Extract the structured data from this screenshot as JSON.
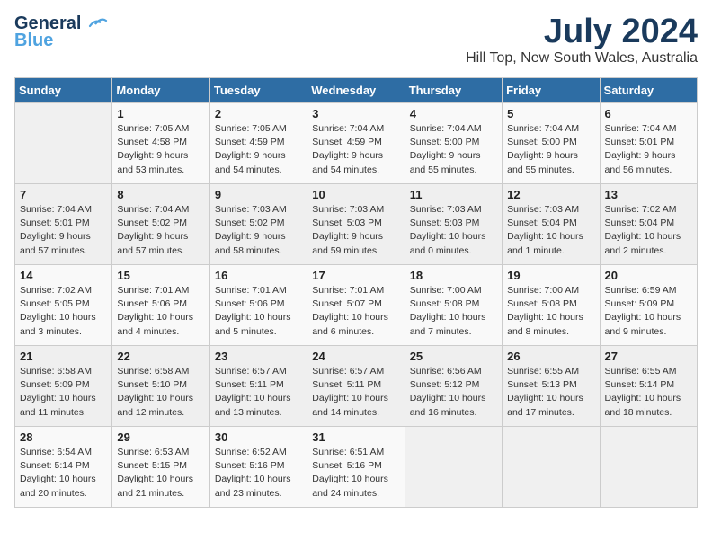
{
  "header": {
    "logo_line1": "General",
    "logo_line2": "Blue",
    "month_title": "July 2024",
    "location": "Hill Top, New South Wales, Australia"
  },
  "days_of_week": [
    "Sunday",
    "Monday",
    "Tuesday",
    "Wednesday",
    "Thursday",
    "Friday",
    "Saturday"
  ],
  "weeks": [
    [
      {
        "day": "",
        "info": ""
      },
      {
        "day": "1",
        "info": "Sunrise: 7:05 AM\nSunset: 4:58 PM\nDaylight: 9 hours\nand 53 minutes."
      },
      {
        "day": "2",
        "info": "Sunrise: 7:05 AM\nSunset: 4:59 PM\nDaylight: 9 hours\nand 54 minutes."
      },
      {
        "day": "3",
        "info": "Sunrise: 7:04 AM\nSunset: 4:59 PM\nDaylight: 9 hours\nand 54 minutes."
      },
      {
        "day": "4",
        "info": "Sunrise: 7:04 AM\nSunset: 5:00 PM\nDaylight: 9 hours\nand 55 minutes."
      },
      {
        "day": "5",
        "info": "Sunrise: 7:04 AM\nSunset: 5:00 PM\nDaylight: 9 hours\nand 55 minutes."
      },
      {
        "day": "6",
        "info": "Sunrise: 7:04 AM\nSunset: 5:01 PM\nDaylight: 9 hours\nand 56 minutes."
      }
    ],
    [
      {
        "day": "7",
        "info": "Sunrise: 7:04 AM\nSunset: 5:01 PM\nDaylight: 9 hours\nand 57 minutes."
      },
      {
        "day": "8",
        "info": "Sunrise: 7:04 AM\nSunset: 5:02 PM\nDaylight: 9 hours\nand 57 minutes."
      },
      {
        "day": "9",
        "info": "Sunrise: 7:03 AM\nSunset: 5:02 PM\nDaylight: 9 hours\nand 58 minutes."
      },
      {
        "day": "10",
        "info": "Sunrise: 7:03 AM\nSunset: 5:03 PM\nDaylight: 9 hours\nand 59 minutes."
      },
      {
        "day": "11",
        "info": "Sunrise: 7:03 AM\nSunset: 5:03 PM\nDaylight: 10 hours\nand 0 minutes."
      },
      {
        "day": "12",
        "info": "Sunrise: 7:03 AM\nSunset: 5:04 PM\nDaylight: 10 hours\nand 1 minute."
      },
      {
        "day": "13",
        "info": "Sunrise: 7:02 AM\nSunset: 5:04 PM\nDaylight: 10 hours\nand 2 minutes."
      }
    ],
    [
      {
        "day": "14",
        "info": "Sunrise: 7:02 AM\nSunset: 5:05 PM\nDaylight: 10 hours\nand 3 minutes."
      },
      {
        "day": "15",
        "info": "Sunrise: 7:01 AM\nSunset: 5:06 PM\nDaylight: 10 hours\nand 4 minutes."
      },
      {
        "day": "16",
        "info": "Sunrise: 7:01 AM\nSunset: 5:06 PM\nDaylight: 10 hours\nand 5 minutes."
      },
      {
        "day": "17",
        "info": "Sunrise: 7:01 AM\nSunset: 5:07 PM\nDaylight: 10 hours\nand 6 minutes."
      },
      {
        "day": "18",
        "info": "Sunrise: 7:00 AM\nSunset: 5:08 PM\nDaylight: 10 hours\nand 7 minutes."
      },
      {
        "day": "19",
        "info": "Sunrise: 7:00 AM\nSunset: 5:08 PM\nDaylight: 10 hours\nand 8 minutes."
      },
      {
        "day": "20",
        "info": "Sunrise: 6:59 AM\nSunset: 5:09 PM\nDaylight: 10 hours\nand 9 minutes."
      }
    ],
    [
      {
        "day": "21",
        "info": "Sunrise: 6:58 AM\nSunset: 5:09 PM\nDaylight: 10 hours\nand 11 minutes."
      },
      {
        "day": "22",
        "info": "Sunrise: 6:58 AM\nSunset: 5:10 PM\nDaylight: 10 hours\nand 12 minutes."
      },
      {
        "day": "23",
        "info": "Sunrise: 6:57 AM\nSunset: 5:11 PM\nDaylight: 10 hours\nand 13 minutes."
      },
      {
        "day": "24",
        "info": "Sunrise: 6:57 AM\nSunset: 5:11 PM\nDaylight: 10 hours\nand 14 minutes."
      },
      {
        "day": "25",
        "info": "Sunrise: 6:56 AM\nSunset: 5:12 PM\nDaylight: 10 hours\nand 16 minutes."
      },
      {
        "day": "26",
        "info": "Sunrise: 6:55 AM\nSunset: 5:13 PM\nDaylight: 10 hours\nand 17 minutes."
      },
      {
        "day": "27",
        "info": "Sunrise: 6:55 AM\nSunset: 5:14 PM\nDaylight: 10 hours\nand 18 minutes."
      }
    ],
    [
      {
        "day": "28",
        "info": "Sunrise: 6:54 AM\nSunset: 5:14 PM\nDaylight: 10 hours\nand 20 minutes."
      },
      {
        "day": "29",
        "info": "Sunrise: 6:53 AM\nSunset: 5:15 PM\nDaylight: 10 hours\nand 21 minutes."
      },
      {
        "day": "30",
        "info": "Sunrise: 6:52 AM\nSunset: 5:16 PM\nDaylight: 10 hours\nand 23 minutes."
      },
      {
        "day": "31",
        "info": "Sunrise: 6:51 AM\nSunset: 5:16 PM\nDaylight: 10 hours\nand 24 minutes."
      },
      {
        "day": "",
        "info": ""
      },
      {
        "day": "",
        "info": ""
      },
      {
        "day": "",
        "info": ""
      }
    ]
  ]
}
